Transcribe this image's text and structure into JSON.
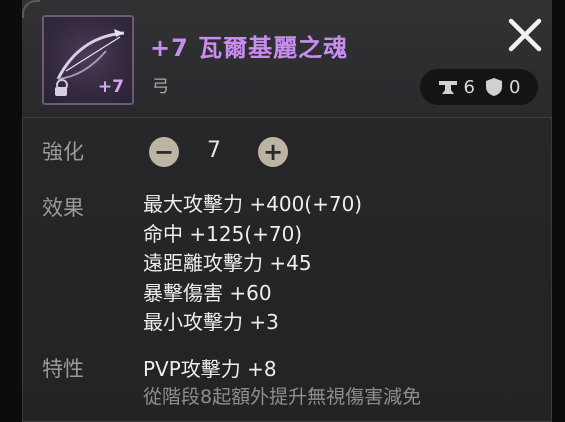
{
  "item": {
    "name": "+7 瓦爾基麗之魂",
    "type": "弓",
    "enhance_badge": "+7",
    "icon": "bow-icon",
    "name_color": "#c78ef0"
  },
  "badges": {
    "upgrade_count": "6",
    "protect_count": "0",
    "upgrade_icon": "anvil-icon",
    "protect_icon": "shield-icon"
  },
  "enhance": {
    "label": "強化",
    "value": "7",
    "minus": "−",
    "plus": "+"
  },
  "effects": {
    "label": "效果",
    "lines": [
      "最大攻擊力 +400(+70)",
      "命中 +125(+70)",
      "遠距離攻擊力 +45",
      "暴擊傷害 +60",
      "最小攻擊力 +3"
    ]
  },
  "traits": {
    "label": "特性",
    "main": "PVP攻擊力 +8",
    "sub": "從階段8起額外提升無視傷害減免"
  }
}
